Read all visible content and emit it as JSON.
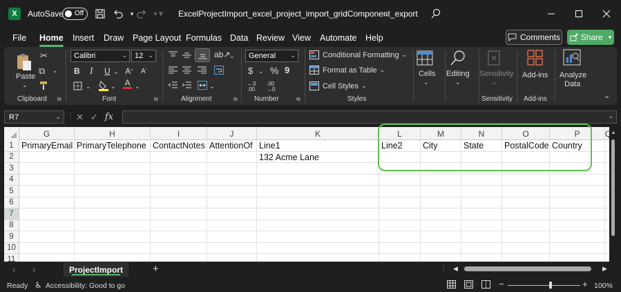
{
  "titlebar": {
    "autosave_label": "AutoSave",
    "autosave_state": "Off",
    "document_title": "ExcelProjectImport_excel_project_import_gridComponent_export"
  },
  "menu": {
    "tabs": [
      "File",
      "Home",
      "Insert",
      "Draw",
      "Page Layout",
      "Formulas",
      "Data",
      "Review",
      "View",
      "Automate",
      "Help"
    ],
    "active": "Home",
    "comments_label": "Comments",
    "share_label": "Share"
  },
  "ribbon": {
    "clipboard": {
      "paste_label": "Paste",
      "group_label": "Clipboard"
    },
    "font": {
      "font_name": "Calibri",
      "font_size": "12",
      "group_label": "Font",
      "bold": "B",
      "italic": "I",
      "underline": "U"
    },
    "alignment": {
      "group_label": "Alignment"
    },
    "number": {
      "format": "General",
      "group_label": "Number"
    },
    "styles": {
      "conditional_formatting": "Conditional Formatting",
      "format_as_table": "Format as Table",
      "cell_styles": "Cell Styles",
      "group_label": "Styles"
    },
    "cells": {
      "label": "Cells"
    },
    "editing": {
      "label": "Editing"
    },
    "sensitivity": {
      "label": "Sensitivity",
      "group_label": "Sensitivity"
    },
    "addins": {
      "label": "Add-ins",
      "group_label": "Add-ins"
    },
    "analyze": {
      "label_line1": "Analyze",
      "label_line2": "Data"
    }
  },
  "formula_bar": {
    "name_box": "R7",
    "fx": "fx",
    "value": ""
  },
  "grid": {
    "columns": [
      "G",
      "H",
      "I",
      "J",
      "K",
      "L",
      "M",
      "N",
      "O",
      "P",
      "Q"
    ],
    "rows": [
      "1",
      "2",
      "3",
      "4",
      "5",
      "6",
      "7",
      "8",
      "9",
      "10",
      "11"
    ],
    "selected_row": "7",
    "row1": {
      "G": "PrimaryEmail",
      "H": "PrimaryTelephone",
      "I": "ContactNotes",
      "J": "AttentionOf",
      "K": "Line1",
      "L": "Line2",
      "M": "City",
      "N": "State",
      "O": "PostalCode",
      "P": "Country"
    },
    "row2": {
      "K": "132 Acme Lane"
    }
  },
  "sheets": {
    "active": "ProjectImport"
  },
  "status": {
    "ready": "Ready",
    "accessibility": "Accessibility: Good to go",
    "zoom": "100%"
  }
}
